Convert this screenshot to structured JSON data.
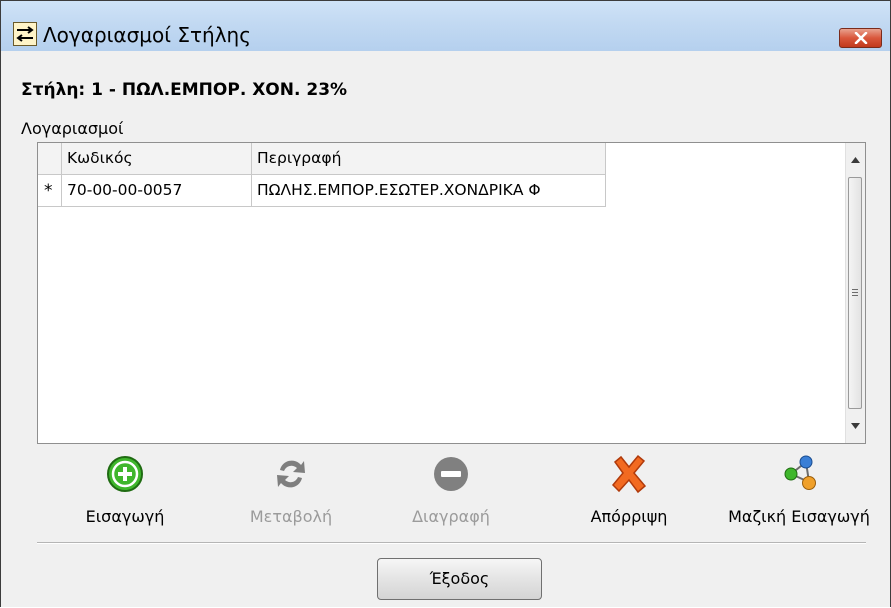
{
  "window": {
    "title": "Λογαριασμοί Στήλης"
  },
  "column_heading": "Στήλη: 1 - ΠΩΛ.ΕΜΠΟΡ. ΧΟΝ.   23%",
  "accounts_label": "Λογαριασμοί",
  "grid": {
    "columns": [
      "Κωδικός",
      "Περιγραφή"
    ],
    "rows": [
      {
        "marker": "*",
        "code": "70-00-00-0057",
        "description": "ΠΩΛΗΣ.ΕΜΠΟΡ.ΕΣΩΤΕΡ.ΧΟΝΔΡΙΚΑ Φ"
      }
    ]
  },
  "toolbar": {
    "insert": "Εισαγωγή",
    "modify": "Μεταβολή",
    "delete": "Διαγραφή",
    "discard": "Απόρριψη",
    "bulk_insert": "Μαζική Εισαγωγή"
  },
  "exit_label": "Έξοδος",
  "icons": {
    "title": "swap-arrows-icon",
    "close": "close-x-icon",
    "insert": "plus-circle-icon",
    "modify": "refresh-icon",
    "delete": "minus-circle-icon",
    "discard": "red-x-icon",
    "bulk_insert": "molecule-nodes-icon"
  },
  "colors": {
    "insert_green": "#3fb62c",
    "discard_orange": "#f26a21",
    "close_red": "#d9573c"
  }
}
